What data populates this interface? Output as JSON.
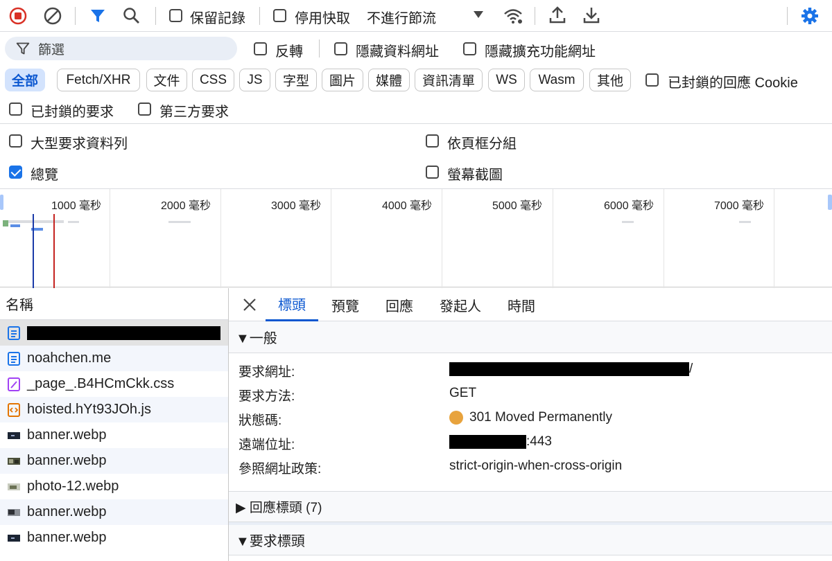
{
  "toolbar": {
    "preserve_log_label": "保留記錄",
    "disable_cache_label": "停用快取",
    "throttling_value": "不進行節流"
  },
  "filter": {
    "placeholder": "篩選",
    "invert_label": "反轉",
    "hide_data_urls_label": "隱藏資料網址",
    "hide_extension_urls_label": "隱藏擴充功能網址"
  },
  "chips": [
    "全部",
    "Fetch/XHR",
    "文件",
    "CSS",
    "JS",
    "字型",
    "圖片",
    "媒體",
    "資訊清單",
    "WS",
    "Wasm",
    "其他"
  ],
  "blocked_cookies_label": "已封鎖的回應 Cookie",
  "blocked_requests_label": "已封鎖的要求",
  "third_party_label": "第三方要求",
  "options": {
    "big_rows_label": "大型要求資料列",
    "group_by_frame_label": "依頁框分組",
    "overview_label": "總覽",
    "screenshots_label": "螢幕截圖"
  },
  "overview_ticks": [
    "1000 毫秒",
    "2000 毫秒",
    "3000 毫秒",
    "4000 毫秒",
    "5000 毫秒",
    "6000 毫秒",
    "7000 毫秒"
  ],
  "requests": {
    "header": "名稱",
    "items": [
      {
        "name": "",
        "type": "document",
        "redacted": true
      },
      {
        "name": "noahchen.me",
        "type": "document"
      },
      {
        "name": "_page_.B4HCmCkk.css",
        "type": "css"
      },
      {
        "name": "hoisted.hYt93JOh.js",
        "type": "js"
      },
      {
        "name": "banner.webp",
        "type": "image-dark"
      },
      {
        "name": "banner.webp",
        "type": "image-photo"
      },
      {
        "name": "photo-12.webp",
        "type": "image-photo2"
      },
      {
        "name": "banner.webp",
        "type": "image-grey"
      },
      {
        "name": "banner.webp",
        "type": "image-dark"
      }
    ]
  },
  "details": {
    "tabs": [
      "標頭",
      "預覽",
      "回應",
      "發起人",
      "時間"
    ],
    "general_title": "▼一般",
    "request_url_label": "要求網址:",
    "request_url_suffix": "/",
    "request_method_label": "要求方法:",
    "request_method_value": "GET",
    "status_code_label": "狀態碼:",
    "status_code_value": "301 Moved Permanently",
    "remote_address_label": "遠端位址:",
    "remote_address_suffix": ":443",
    "referrer_policy_label": "參照網址政策:",
    "referrer_policy_value": "strict-origin-when-cross-origin",
    "response_headers_title": "▶ 回應標頭 (7)",
    "request_headers_title": "▼要求標頭"
  },
  "colors": {
    "accent": "#1a73e8",
    "record_red": "#d93025",
    "status_warning": "#e8a33d"
  }
}
